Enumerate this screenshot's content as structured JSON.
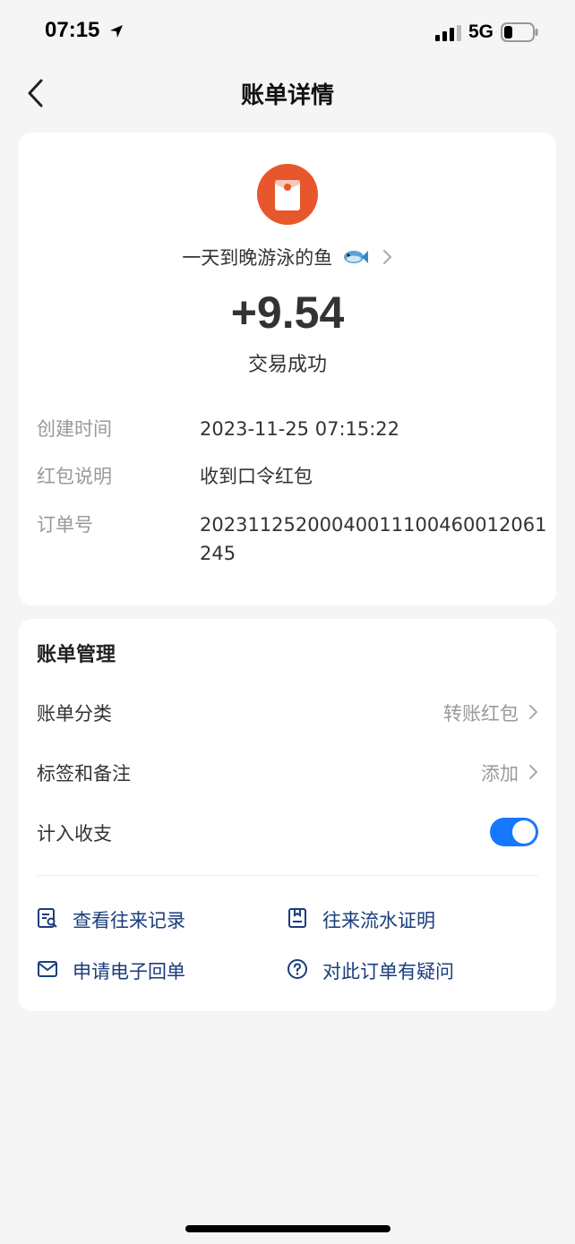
{
  "status_bar": {
    "time": "07:15",
    "network": "5G"
  },
  "nav": {
    "title": "账单详情"
  },
  "summary": {
    "payer_name": "一天到晚游泳的鱼",
    "amount": "+9.54",
    "status": "交易成功"
  },
  "details": [
    {
      "label": "创建时间",
      "value": "2023-11-25 07:15:22"
    },
    {
      "label": "红包说明",
      "value": "收到口令红包"
    },
    {
      "label": "订单号",
      "value": "20231125200040011100460012061245"
    }
  ],
  "management": {
    "title": "账单管理",
    "category": {
      "label": "账单分类",
      "value": "转账红包"
    },
    "tags": {
      "label": "标签和备注",
      "value": "添加"
    },
    "count": {
      "label": "计入收支",
      "enabled": true
    },
    "actions": [
      {
        "label": "查看往来记录",
        "icon": "record-search-icon"
      },
      {
        "label": "往来流水证明",
        "icon": "statement-doc-icon"
      },
      {
        "label": "申请电子回单",
        "icon": "mail-icon"
      },
      {
        "label": "对此订单有疑问",
        "icon": "question-circle-icon"
      }
    ]
  },
  "colors": {
    "accent": "#1677ff",
    "link": "#1a3d7c",
    "red_packet": "#e8572b"
  }
}
